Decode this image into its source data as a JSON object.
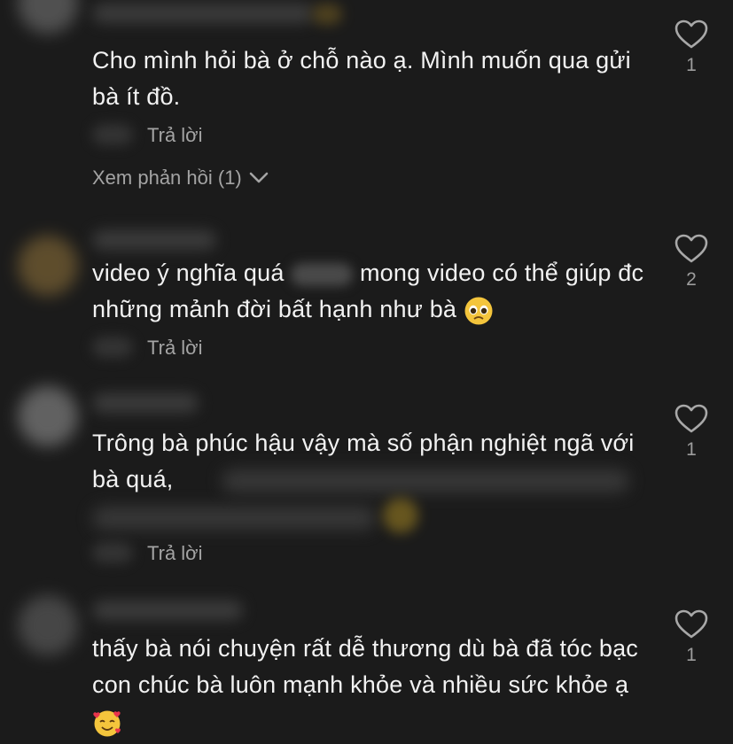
{
  "comments": [
    {
      "text": "Cho mình hỏi bà ở chỗ nào ạ. Mình muốn qua gửi bà ít đồ.",
      "reply_label": "Trả lời",
      "view_replies_label": "Xem phản hồi (1)",
      "likes": "1"
    },
    {
      "text_part1": "video ý nghĩa quá",
      "text_part2": "mong video có thể giúp đc những mảnh đời bất hạnh như bà",
      "reply_label": "Trả lời",
      "likes": "2"
    },
    {
      "text": "Trông bà phúc hậu vậy mà số phận nghiệt ngã với bà quá,",
      "reply_label": "Trả lời",
      "likes": "1"
    },
    {
      "text": "thấy bà nói chuyện rất dễ thương dù bà đã tóc bạc con chúc bà luôn mạnh khỏe và nhiều sức khỏe ạ",
      "likes": "1"
    }
  ],
  "icons": {
    "like": "heart-outline-icon",
    "expand": "chevron-down-icon",
    "emoji_pleading": "pleading-face-emoji",
    "emoji_love": "smiling-face-with-hearts-emoji"
  },
  "colors": {
    "background": "#1b1b1b",
    "text": "#f2f2f2",
    "secondary": "#a4a4a4"
  }
}
